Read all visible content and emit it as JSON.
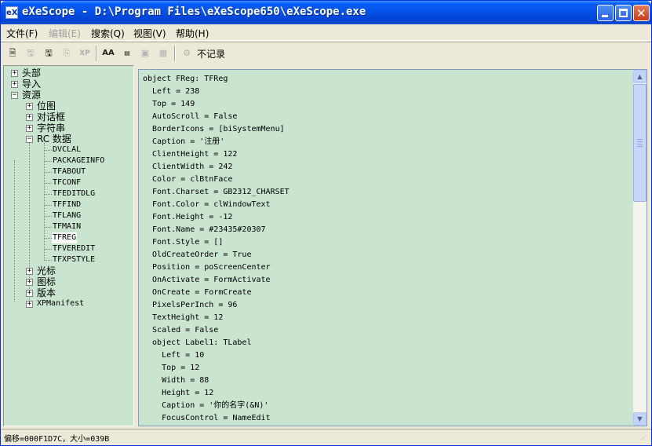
{
  "window": {
    "title": "eXeScope - D:\\Program Files\\eXeScope650\\eXeScope.exe",
    "icon": "eX"
  },
  "menu": [
    {
      "label": "文件(F)",
      "enabled": true
    },
    {
      "label": "编辑(E)",
      "enabled": false
    },
    {
      "label": "搜索(Q)",
      "enabled": true
    },
    {
      "label": "视图(V)",
      "enabled": true
    },
    {
      "label": "帮助(H)",
      "enabled": true
    }
  ],
  "toolbar": {
    "record_label": "不记录",
    "icons": [
      "open-file-icon",
      "save-icon",
      "save-as-icon",
      "copy-icon",
      "xp-manifest-icon",
      "font-icon",
      "binary-icon",
      "image-icon",
      "resource-icon",
      "wizard-icon"
    ]
  },
  "tree": {
    "root_items": [
      "头部",
      "导入",
      "资源"
    ],
    "resources": [
      "位图",
      "对话框",
      "字符串",
      "RC 数据"
    ],
    "rcdata": [
      "DVCLAL",
      "PACKAGEINFO",
      "TFABOUT",
      "TFCONF",
      "TFEDITDLG",
      "TFFIND",
      "TFLANG",
      "TFMAIN",
      "TFREG",
      "TFVEREDIT",
      "TFXPSTYLE"
    ],
    "after": [
      "光标",
      "图标",
      "版本",
      "XPManifest"
    ],
    "selected": "TFREG"
  },
  "content": {
    "lines": [
      "object FReg: TFReg",
      "  Left = 238",
      "  Top = 149",
      "  AutoScroll = False",
      "  BorderIcons = [biSystemMenu]",
      "  Caption = '注册'",
      "  ClientHeight = 122",
      "  ClientWidth = 242",
      "  Color = clBtnFace",
      "  Font.Charset = GB2312_CHARSET",
      "  Font.Color = clWindowText",
      "  Font.Height = -12",
      "  Font.Name = #23435#20307",
      "  Font.Style = []",
      "  OldCreateOrder = True",
      "  Position = poScreenCenter",
      "  OnActivate = FormActivate",
      "  OnCreate = FormCreate",
      "  PixelsPerInch = 96",
      "  TextHeight = 12",
      "  Scaled = False",
      "  object Label1: TLabel",
      "    Left = 10",
      "    Top = 12",
      "    Width = 88",
      "    Height = 12",
      "    Caption = '你的名字(&N)'",
      "    FocusControl = NameEdit"
    ]
  },
  "status": {
    "text": "偏移=000F1D7C，大小=039B"
  }
}
